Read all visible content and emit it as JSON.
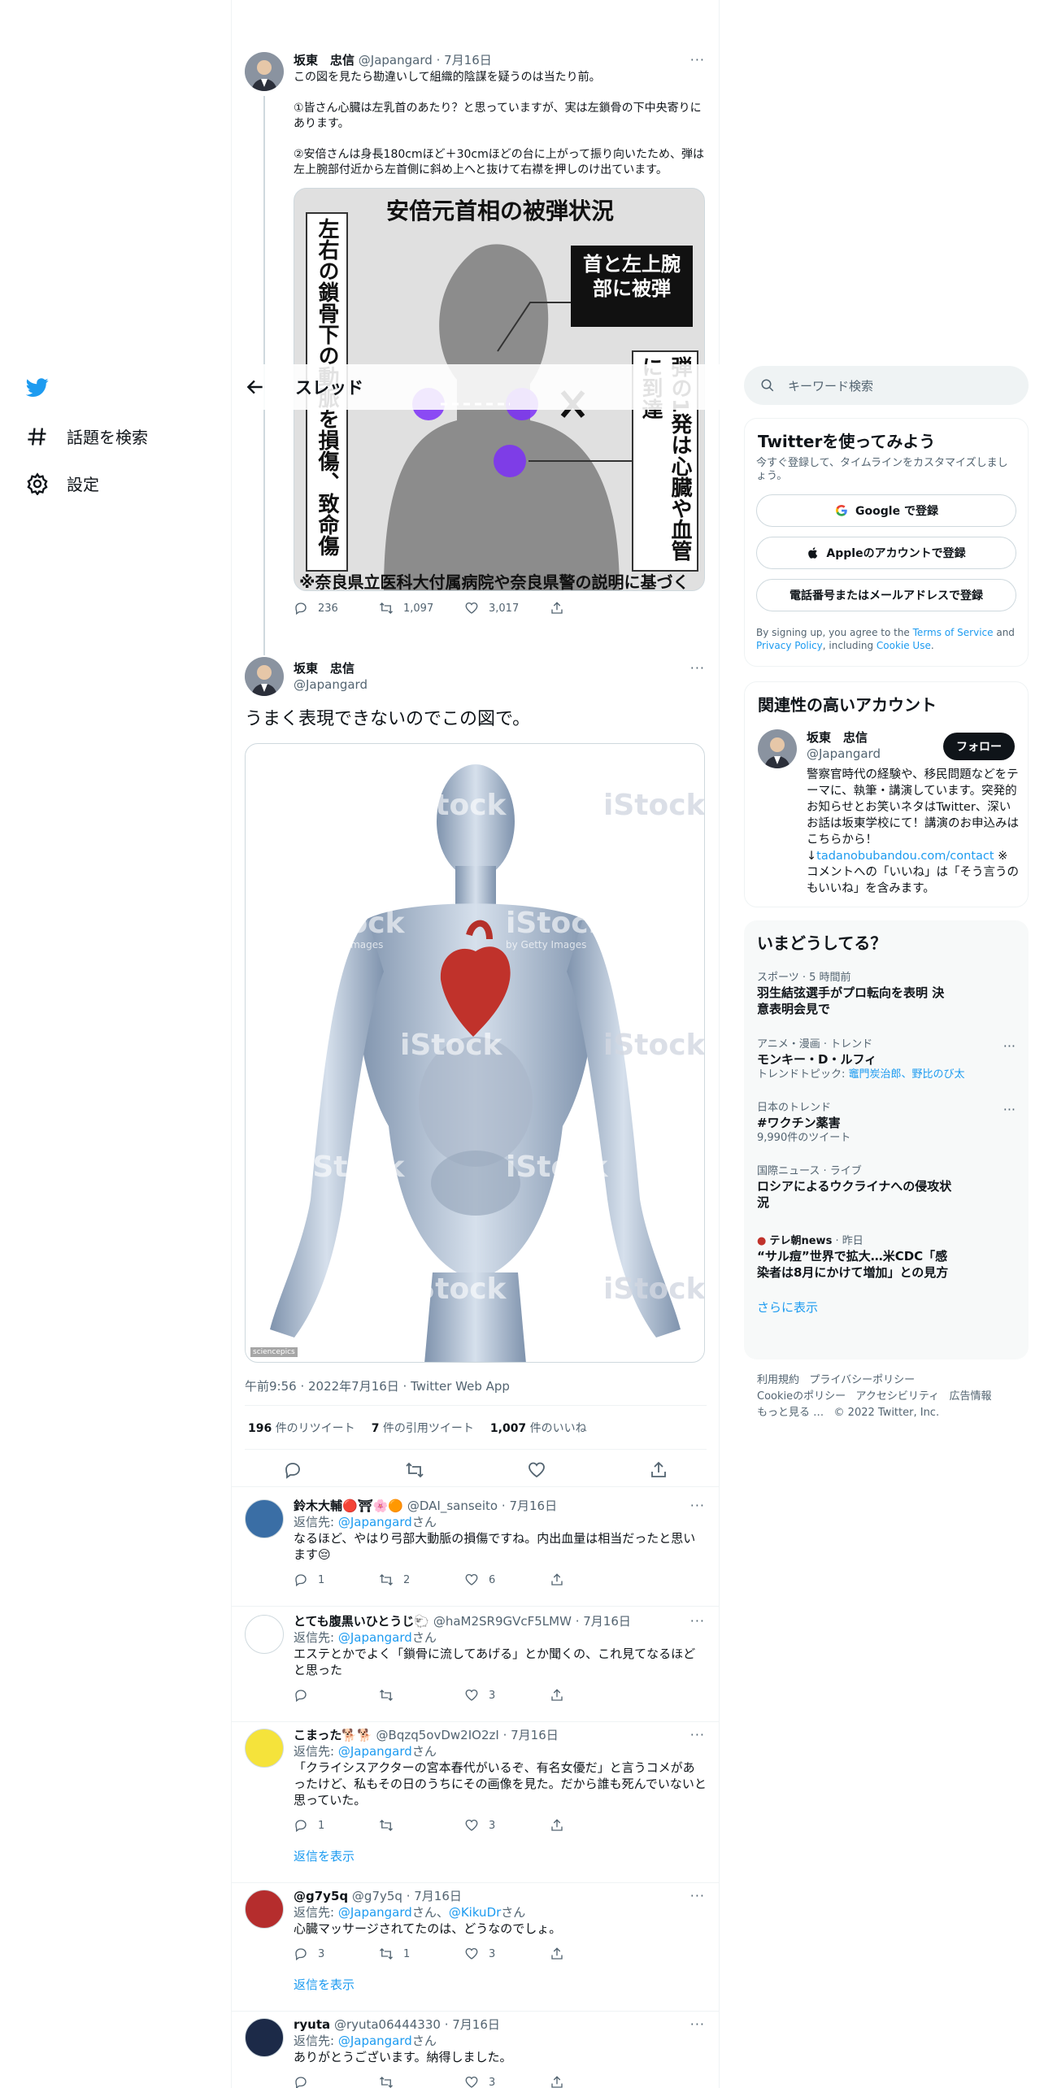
{
  "nav": {
    "explore": "話題を検索",
    "settings": "設定"
  },
  "thread": {
    "title": "スレッド"
  },
  "tweet1": {
    "name": "坂東　忠信",
    "handle": "@Japangard",
    "date": "7月16日",
    "text": "この図を見たら勘違いして組織的陰謀を疑うのは当たり前。\n\n①皆さん心臓は左乳首のあたり？と思っていますが、実は左鎖骨の下中央寄りにあります。\n\n②安倍さんは身長180cmほど＋30cmほどの台に上がって振り向いたため、弾は左上腕部付近から左首側に斜め上へと抜けて右襟を押しのけ出ています。",
    "image": {
      "title": "安倍元首相の被弾状況",
      "left_vertical": "左右の鎖骨下の動脈を損傷、致命傷に",
      "callout": "首と左上腕部に被弾",
      "right_vertical": "弾の1発は心臓や血管に到達",
      "source": "※奈良県立医科大付属病院や奈良県警の説明に基づく"
    },
    "replies": "236",
    "retweets": "1,097",
    "likes": "3,017"
  },
  "main_tweet": {
    "name": "坂東　忠信",
    "handle": "@Japangard",
    "text": "うまく表現できないのでこの図で。",
    "watermark": "iStock",
    "watermark_sub": "by Getty Images",
    "credit": "sciencepics",
    "timestamp": "午前9:56 · 2022年7月16日 · Twitter Web App",
    "retweets_num": "196",
    "retweets_label": "件のリツイート",
    "quotes_num": "7",
    "quotes_label": "件の引用ツイート",
    "likes_num": "1,007",
    "likes_label": "件のいいね"
  },
  "replies": [
    {
      "name": "鈴木大輔🔴⛩🌸🟠",
      "handle": "@DAI_sanseito",
      "date": "7月16日",
      "reply_prefix": "返信先: ",
      "reply_to": "@Japangard",
      "reply_suffix": "さん",
      "text": "なるほど、やはり弓部大動脈の損傷ですね。内出血量は相当だったと思います😔",
      "replies": "1",
      "retweets": "2",
      "likes": "6"
    },
    {
      "name": "とても腹黒いひとうじ🐑",
      "handle": "@haM2SR9GVcF5LMW",
      "date": "7月16日",
      "reply_prefix": "返信先: ",
      "reply_to": "@Japangard",
      "reply_suffix": "さん",
      "text": "エステとかでよく「鎖骨に流してあげる」とか聞くの、これ見てなるほどと思った",
      "replies": "",
      "retweets": "",
      "likes": "3"
    },
    {
      "name": "こまった🐕🐕",
      "handle": "@Bqzq5ovDw2IO2zI",
      "date": "7月16日",
      "reply_prefix": "返信先: ",
      "reply_to": "@Japangard",
      "reply_suffix": "さん",
      "text": "「クライシスアクターの宮本春代がいるぞ、有名女優だ」と言うコメがあったけど、私もその日のうちにその画像を見た。だから誰も死んでいないと思っていた。",
      "replies": "1",
      "retweets": "",
      "likes": "3",
      "show_replies": "返信を表示"
    },
    {
      "name": "@g7y5q",
      "handle": "@g7y5q",
      "date": "7月16日",
      "reply_prefix": "返信先: ",
      "reply_to": "@Japangard",
      "reply_mid": "さん、",
      "reply_to2": "@KikuDr",
      "reply_suffix": "さん",
      "text": "心臓マッサージされてたのは、どうなのでしょ。",
      "replies": "3",
      "retweets": "1",
      "likes": "3",
      "show_replies": "返信を表示"
    },
    {
      "name": "ryuta",
      "handle": "@ryuta06444330",
      "date": "7月16日",
      "reply_prefix": "返信先: ",
      "reply_to": "@Japangard",
      "reply_suffix": "さん",
      "text": "ありがとうございます。納得しました。",
      "replies": "",
      "retweets": "",
      "likes": "3"
    }
  ],
  "search": {
    "placeholder": "キーワード検索"
  },
  "signup": {
    "title": "Twitterを使ってみよう",
    "subtitle": "今すぐ登録して、タイムラインをカスタマイズしましょう。",
    "google": "Google で登録",
    "apple": "Appleのアカウントで登録",
    "phone": "電話番号またはメールアドレスで登録",
    "terms_prefix": "By signing up, you agree to the ",
    "terms": "Terms of Service",
    "and": " and ",
    "privacy": "Privacy Policy",
    "including": ", including ",
    "cookie": "Cookie Use",
    "period": "."
  },
  "related": {
    "title": "関連性の高いアカウント",
    "name": "坂東　忠信",
    "handle": "@Japangard",
    "follow": "フォロー",
    "bio_1": "警察官時代の経験や、移民問題などをテーマに、執筆・講演しています。突発的お知らせとお笑いネタはTwitter、深いお話は坂東学校にて！講演のお申込みはこちらから！↓",
    "bio_link": "tadanobubandou.com/contact",
    "bio_2": " ※ コメントへの「いいね」は「そう言うのもいいね」を含みます。"
  },
  "trends": {
    "title": "いまどうしてる？",
    "items": [
      {
        "cat": "スポーツ · 5 時間前",
        "name": "羽生結弦選手がプロ転向を表明 決意表明会見で"
      },
      {
        "cat": "アニメ・漫画 · トレンド",
        "name": "モンキー・D・ルフィ",
        "sub_prefix": "トレンドトピック: ",
        "sub_links": "竈門炭治郎、野比のび太"
      },
      {
        "cat": "日本のトレンド",
        "name": "#ワクチン薬害",
        "sub": "9,990件のツイート"
      },
      {
        "cat": "国際ニュース · ライブ",
        "name": "ロシアによるウクライナへの侵攻状況"
      },
      {
        "cat_src": "テレ朝news",
        "cat_time": " · 昨日",
        "name": "“サル痘”世界で拡大…米CDC「感染者は8月にかけて増加」との見方"
      }
    ],
    "show_more": "さらに表示"
  },
  "footer": {
    "l1a": "利用規約",
    "l1b": "プライバシーポリシー",
    "l2a": "Cookieのポリシー",
    "l2b": "アクセシビリティ",
    "l2c": "広告情報",
    "l3a": "もっと見る …",
    "l3b": "© 2022 Twitter, Inc."
  },
  "colors": {
    "accent": "#1d9bf0",
    "text": "#0f1419",
    "muted": "#536471",
    "border": "#eff3f4"
  }
}
